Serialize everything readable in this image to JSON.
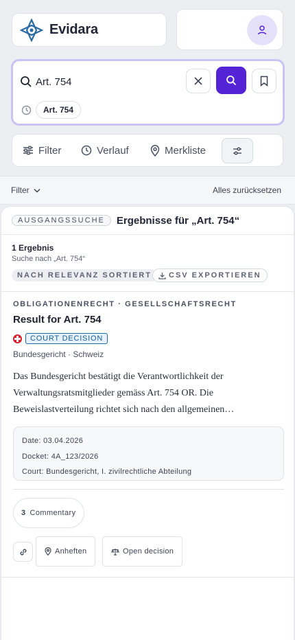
{
  "brand": {
    "name": "Evidara",
    "color": "#2b6aa3",
    "icon": "evidara-logo"
  },
  "user": {
    "icon": "user-icon",
    "accent": "#5423d6"
  },
  "search": {
    "value": "Art. 754",
    "placeholder": "",
    "recent_chip": "Art. 754",
    "icons": [
      "search-icon",
      "close-icon",
      "search-icon",
      "bookmark-icon",
      "clock-icon"
    ],
    "button_color": "#5423d6"
  },
  "toolbar": {
    "filter": "Filter",
    "history": "Verlauf",
    "watchlist": "Merkliste"
  },
  "filterbar": {
    "filter": "Filter",
    "reset": "Alles zurücksetzen"
  },
  "results": {
    "origin_tag": "AUSGANGSSUCHE",
    "title": "Ergebnisse für „Art. 754“",
    "count": "1 Ergebnis",
    "search_for": "Suche nach „Art. 754“",
    "sort": "NACH RELEVANZ SORTIERT",
    "export": "CSV EXPORTIEREN",
    "items": [
      {
        "breadcrumb": "OBLIGATIONENRECHT · GESELLSCHAFTSRECHT",
        "title": "Result for Art. 754",
        "type": "COURT DECISION",
        "court": "Bundesgericht · Schweiz",
        "excerpt": "Das Bundesgericht bestätigt die Verantwortlichkeit der Verwaltungsratsmitglieder gemäss Art. 754 OR. Die Beweislastverteilung richtet sich nach den allgemeinen…",
        "meta": {
          "date": "Date: 03.04.2026",
          "docket": "Docket: 4A_123/2026",
          "court": "Court: Bundesgericht, I. zivilrechtliche Abteilung"
        },
        "commentary_count": "3",
        "commentary_label": "Commentary",
        "pin": "Anheften",
        "open": "Open decision"
      }
    ]
  }
}
